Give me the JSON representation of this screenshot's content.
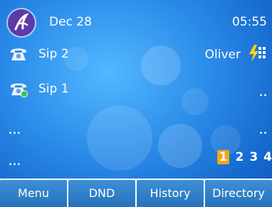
{
  "status_bar": {
    "date": "Dec 28",
    "time": "05:55"
  },
  "lines": [
    {
      "label": "Sip 2",
      "icon": "phone-icon"
    },
    {
      "label": "Sip 1",
      "icon": "phone-registered-icon"
    }
  ],
  "contact": {
    "name": "Oliver",
    "icon": "bolt-keypad-icon"
  },
  "placeholders": [
    "...",
    "...",
    "..",
    ".."
  ],
  "pages": [
    "1",
    "2",
    "3",
    "4"
  ],
  "active_page": "1",
  "softkeys": [
    "Menu",
    "DND",
    "History",
    "Directory"
  ],
  "colors": {
    "background": "#2a8ae8",
    "softkey": "#2f7bc6",
    "page_active": "#f3a61c",
    "logo": "#5d3aa8"
  }
}
